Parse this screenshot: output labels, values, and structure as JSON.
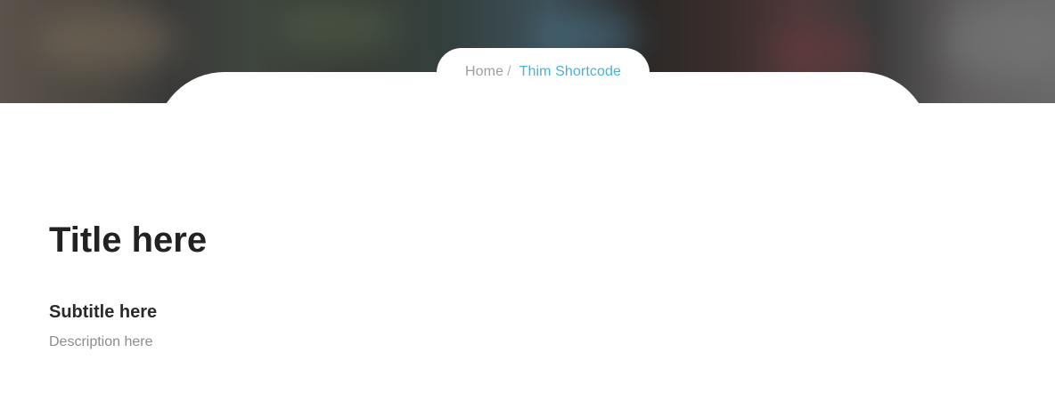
{
  "breadcrumb": {
    "home_label": "Home",
    "separator": "/",
    "current_label": "Thim Shortcode"
  },
  "main": {
    "title": "Title here",
    "subtitle": "Subtitle here",
    "description": "Description here"
  },
  "colors": {
    "accent": "#45b4d8",
    "title_text": "#222222",
    "muted_text": "#8c8c8c"
  }
}
